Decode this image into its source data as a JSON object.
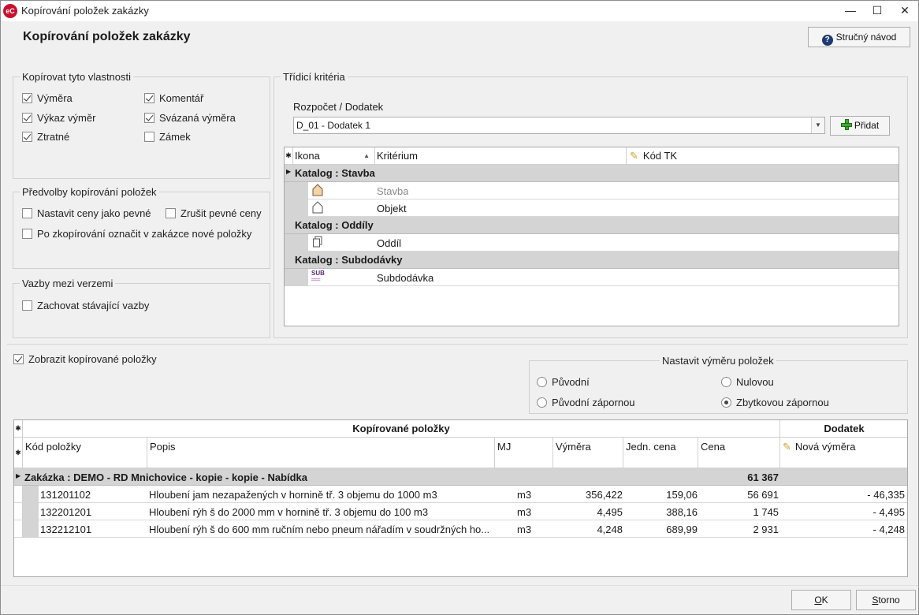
{
  "window": {
    "app_icon": "eC",
    "title": "Kopírování položek zakázky",
    "controls": [
      "minimize-icon",
      "maximize-icon",
      "close-icon"
    ]
  },
  "header": {
    "title": "Kopírování položek zakázky",
    "help_label": "Stručný návod"
  },
  "copy_properties": {
    "legend": "Kopírovat tyto vlastnosti",
    "options": [
      {
        "label": "Výměra",
        "checked": true
      },
      {
        "label": "Komentář",
        "checked": true
      },
      {
        "label": "Výkaz výměr",
        "checked": true
      },
      {
        "label": "Svázaná výměra",
        "checked": true
      },
      {
        "label": "Ztratné",
        "checked": true
      },
      {
        "label": "Zámek",
        "checked": false
      }
    ]
  },
  "copy_presets": {
    "legend": "Předvolby kopírování položek",
    "options": [
      {
        "label": "Nastavit ceny jako pevné",
        "checked": false
      },
      {
        "label": "Zrušit pevné ceny",
        "checked": false
      },
      {
        "label": "Po zkopírování označit v zakázce nové položky",
        "checked": false
      }
    ]
  },
  "version_links": {
    "legend": "Vazby mezi verzemi",
    "options": [
      {
        "label": "Zachovat stávající vazby",
        "checked": false
      }
    ]
  },
  "sort_criteria": {
    "legend": "Třídicí kritéria",
    "select_label": "Rozpočet / Dodatek",
    "select_value": "D_01 - Dodatek 1",
    "add_label": "Přidat",
    "columns": {
      "icon": "Ikona",
      "criterion": "Kritérium",
      "code": "Kód TK"
    },
    "groups": [
      {
        "title": "Katalog : Stavba",
        "rows": [
          {
            "icon": "house-filled-icon",
            "label": "Stavba",
            "muted": true
          },
          {
            "icon": "house-outline-icon",
            "label": "Objekt",
            "muted": false
          }
        ]
      },
      {
        "title": "Katalog : Oddíly",
        "rows": [
          {
            "icon": "pages-icon",
            "label": "Oddíl",
            "muted": false
          }
        ]
      },
      {
        "title": "Katalog : Subdodávky",
        "rows": [
          {
            "icon": "sub-icon",
            "label": "Subdodávka",
            "muted": false
          }
        ]
      }
    ]
  },
  "show_copied": {
    "label": "Zobrazit kopírované položky",
    "checked": true
  },
  "set_quantity": {
    "legend": "Nastavit výměru položek",
    "options": [
      {
        "label": "Původní",
        "selected": false
      },
      {
        "label": "Nulovou",
        "selected": false
      },
      {
        "label": "Původní zápornou",
        "selected": false
      },
      {
        "label": "Zbytkovou zápornou",
        "selected": true
      }
    ]
  },
  "items_grid": {
    "band_left": "Kopírované položky",
    "band_right": "Dodatek",
    "columns": [
      "Kód položky",
      "Popis",
      "MJ",
      "Výměra",
      "Jedn. cena",
      "Cena",
      "Nová výměra"
    ],
    "group": {
      "title": "Zakázka : DEMO - RD Mnichovice - kopie - kopie - Nabídka",
      "total": "61 367"
    },
    "rows": [
      {
        "code": "131201102",
        "desc": "Hloubení jam nezapažených v hornině tř. 3 objemu do 1000 m3",
        "unit": "m3",
        "qty": "356,422",
        "unit_price": "159,06",
        "price": "56 691",
        "new_qty": "- 46,335"
      },
      {
        "code": "132201201",
        "desc": "Hloubení rýh š do 2000 mm v hornině tř. 3 objemu do 100 m3",
        "unit": "m3",
        "qty": "4,495",
        "unit_price": "388,16",
        "price": "1 745",
        "new_qty": "- 4,495"
      },
      {
        "code": "132212101",
        "desc": "Hloubení rýh š do 600 mm ručním nebo pneum nářadím v soudržných ho...",
        "unit": "m3",
        "qty": "4,248",
        "unit_price": "689,99",
        "price": "2 931",
        "new_qty": "- 4,248"
      }
    ]
  },
  "footer": {
    "ok_label": "OK",
    "cancel_label": "Storno"
  }
}
